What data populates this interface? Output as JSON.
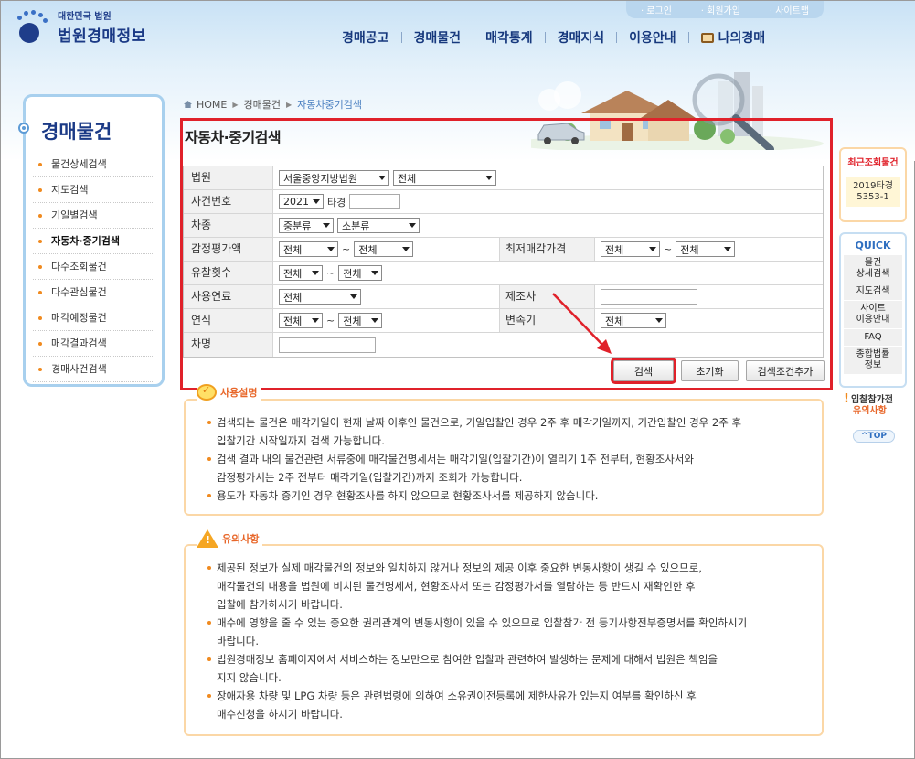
{
  "header": {
    "logo_small": "대한민국 법원",
    "logo_big": "법원경매정보",
    "util_links": [
      "로그인",
      "회원가입",
      "사이트맵"
    ],
    "nav": [
      "경매공고",
      "경매물건",
      "매각통계",
      "경매지식",
      "이용안내",
      "나의경매"
    ]
  },
  "sidebar": {
    "title": "경매물건",
    "items": [
      {
        "label": "물건상세검색"
      },
      {
        "label": "지도검색"
      },
      {
        "label": "기일별검색"
      },
      {
        "label": "자동차·중기검색",
        "active": true
      },
      {
        "label": "다수조회물건"
      },
      {
        "label": "다수관심물건"
      },
      {
        "label": "매각예정물건"
      },
      {
        "label": "매각결과검색"
      },
      {
        "label": "경매사건검색"
      }
    ]
  },
  "breadcrumb": [
    "HOME",
    "경매물건",
    "자동차중기검색"
  ],
  "page_title": "자동차·중기검색",
  "form": {
    "court_label": "법원",
    "court_value": "서울중앙지방법원",
    "court_sub_value": "전체",
    "case_label": "사건번호",
    "case_year": "2021",
    "case_type": "타경",
    "vehicle_label": "차종",
    "vehicle_mid": "중분류",
    "vehicle_small": "소분류",
    "appraisal_label": "감정평가액",
    "appraisal_from": "전체",
    "appraisal_to": "전체",
    "min_price_label": "최저매각가격",
    "min_price_from": "전체",
    "min_price_to": "전체",
    "fail_count_label": "유찰횟수",
    "fail_from": "전체",
    "fail_to": "전체",
    "fuel_label": "사용연료",
    "fuel_value": "전체",
    "maker_label": "제조사",
    "year_label": "연식",
    "year_from": "전체",
    "year_to": "전체",
    "transmission_label": "변속기",
    "transmission_value": "전체",
    "car_name_label": "차명",
    "tilde": "~"
  },
  "buttons": {
    "search": "검색",
    "reset": "초기화",
    "add_condition": "검색조건추가"
  },
  "usage": {
    "title": "사용설명",
    "items": [
      "검색되는 물건은 매각기일이 현재 날짜 이후인 물건으로, 기일입찰인 경우 2주 후 매각기일까지, 기간입찰인 경우 2주 후\n입찰기간 시작일까지 검색 가능합니다.",
      "검색 결과 내의 물건관련 서류중에 매각물건명세서는 매각기일(입찰기간)이 열리기 1주 전부터, 현황조사서와\n감정평가서는 2주 전부터 매각기일(입찰기간)까지 조회가 가능합니다.",
      "용도가 자동차 중기인 경우 현황조사를 하지 않으므로 현황조사서를 제공하지 않습니다."
    ]
  },
  "caution": {
    "title": "유의사항",
    "items": [
      "제공된 정보가 실제 매각물건의 정보와 일치하지 않거나 정보의 제공 이후 중요한 변동사항이 생길 수 있으므로,\n매각물건의 내용을 법원에 비치된 물건명세서, 현황조사서 또는 감정평가서를 열람하는 등 반드시 재확인한 후\n입찰에 참가하시기 바랍니다.",
      "매수에 영향을 줄 수 있는 중요한 권리관계의 변동사항이 있을 수 있으므로 입찰참가 전 등기사항전부증명서를 확인하시기\n바랍니다.",
      "법원경매정보 홈페이지에서 서비스하는 정보만으로 참여한 입찰과 관련하여 발생하는 문제에 대해서 법원은 책임을\n지지 않습니다.",
      "장애자용 차량 및 LPG 차량 등은 관련법령에 의하여 소유권이전등록에 제한사유가 있는지 여부를 확인하신 후\n매수신청을 하시기 바랍니다."
    ]
  },
  "right": {
    "recent_title": "최근조회물건",
    "recent_item": "2019타경\n5353-1",
    "quick_title": "QUICK",
    "quick_links": [
      "물건\n상세검색",
      "지도검색",
      "사이트\n이용안내",
      "FAQ",
      "종합법률\n정보"
    ],
    "bid_note_line1": "입찰참가전",
    "bid_note_line2": "유의사항",
    "top": "TOP"
  },
  "colors": {
    "brand": "#1b3a86",
    "highlight": "#e0212a",
    "accent": "#f08a1f"
  }
}
